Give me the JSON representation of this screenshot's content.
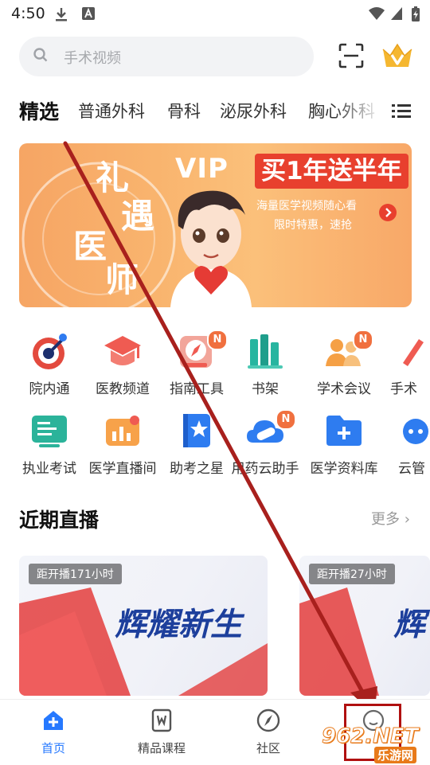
{
  "status_bar": {
    "time": "4:50"
  },
  "search": {
    "placeholder": "手术视频"
  },
  "tabs": [
    "精选",
    "普通外科",
    "骨科",
    "泌尿外科",
    "胸心外科"
  ],
  "banner": {
    "vertical_chars": [
      "礼",
      "遇",
      "医",
      "师"
    ],
    "vip_text": "VIP",
    "headline": "买1年送半年",
    "line1": "海量医学视频随心看",
    "line2": "限时特惠，速抢"
  },
  "grid": {
    "row1": [
      {
        "label": "院内通",
        "icon": "target-icon",
        "badge": ""
      },
      {
        "label": "医教频道",
        "icon": "graduation-cap-icon",
        "badge": ""
      },
      {
        "label": "指南工具",
        "icon": "compass-guide-icon",
        "badge": "N"
      },
      {
        "label": "书架",
        "icon": "bookshelf-icon",
        "badge": ""
      },
      {
        "label": "学术会议",
        "icon": "meeting-people-icon",
        "badge": "N"
      },
      {
        "label": "手术",
        "icon": "scalpel-icon",
        "badge": ""
      }
    ],
    "row2": [
      {
        "label": "执业考试",
        "icon": "exam-board-icon",
        "badge": ""
      },
      {
        "label": "医学直播间",
        "icon": "live-chart-icon",
        "badge": ""
      },
      {
        "label": "助考之星",
        "icon": "star-book-icon",
        "badge": ""
      },
      {
        "label": "用药云助手",
        "icon": "cloud-pill-icon",
        "badge": "N"
      },
      {
        "label": "医学资料库",
        "icon": "folder-plus-icon",
        "badge": ""
      },
      {
        "label": "云管",
        "icon": "cloud-network-icon",
        "badge": ""
      }
    ]
  },
  "live": {
    "title": "近期直播",
    "more": "更多",
    "cards": [
      {
        "countdown": "距开播171小时",
        "title": "辉耀新生"
      },
      {
        "countdown": "距开播27小时",
        "title": "辉"
      }
    ]
  },
  "nav": [
    {
      "label": "首页",
      "icon": "home-plus-icon"
    },
    {
      "label": "精品课程",
      "icon": "course-book-icon"
    },
    {
      "label": "社区",
      "icon": "compass-icon"
    },
    {
      "label": "",
      "icon": "profile-icon"
    }
  ],
  "watermark": {
    "top": "962.NET",
    "bottom": "乐游网"
  },
  "colors": {
    "accent": "#2679ff",
    "banner": "#f9b46e",
    "badge": "#f0703f",
    "highlight": "#b01010"
  }
}
